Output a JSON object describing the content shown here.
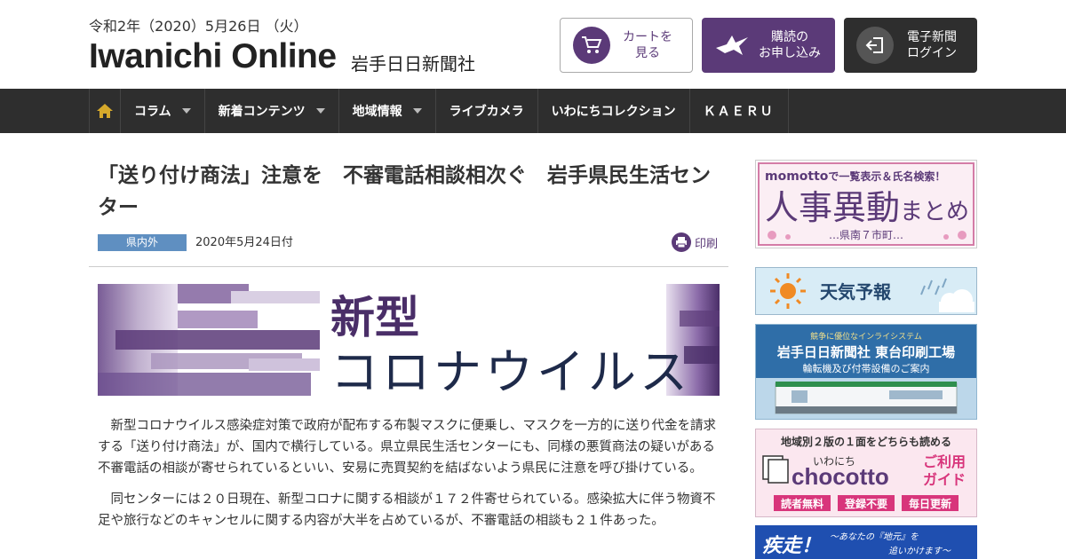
{
  "header": {
    "date": "令和2年（2020）5月26日 （火）",
    "logo": "Iwanichi Online",
    "logo_sub": "岩手日日新聞社",
    "cart_label": "カートを\n見る",
    "subscribe_label": "購読の\nお申し込み",
    "epaper_label": "電子新聞\nログイン"
  },
  "nav": {
    "items": [
      {
        "label": "コラム",
        "dropdown": true
      },
      {
        "label": "新着コンテンツ",
        "dropdown": true
      },
      {
        "label": "地域情報",
        "dropdown": true
      },
      {
        "label": "ライブカメラ",
        "dropdown": false
      },
      {
        "label": "いわにちコレクション",
        "dropdown": false
      },
      {
        "label": "ＫＡＥＲＵ",
        "dropdown": false
      }
    ]
  },
  "article": {
    "title": "「送り付け商法」注意を　不審電話相談相次ぐ　岩手県民生活センター",
    "category": "県内外",
    "date": "2020年5月24日付",
    "print_label": "印刷",
    "banner_line1": "新型",
    "banner_line2": "コロナウイルス",
    "paragraphs": [
      "新型コロナウイルス感染症対策で政府が配布する布製マスクに便乗し、マスクを一方的に送り代金を請求する「送り付け商法」が、国内で横行している。県立県民生活センターにも、同様の悪質商法の疑いがある不審電話の相談が寄せられているといい、安易に売買契約を結ばないよう県民に注意を呼び掛けている。",
      "同センターには２０日現在、新型コロナに関する相談が１７２件寄せられている。感染拡大に伴う物資不足や旅行などのキャンセルに関する内容が大半を占めているが、不審電話の相談も２１件あった。"
    ]
  },
  "sidebar": {
    "ad1": {
      "top_text_brand": "momotto",
      "top_text_rest": "で一覧表示＆氏名検索！",
      "main_big": "人事異動",
      "main_small": "まとめ",
      "bottom": "…県南７市町…"
    },
    "ad2": {
      "label": "天気予報"
    },
    "ad3": {
      "tagline": "競争に優位なインライシステム",
      "title": "岩手日日新聞社 東台印刷工場",
      "subtitle": "輪転機及び付帯設備のご案内"
    },
    "ad4": {
      "top": "地域別２版の１面をどちらも読める",
      "brand_small": "いわにち",
      "brand": "chocotto",
      "usage1": "ご利用",
      "usage2": "ガイド",
      "tag1": "読者無料",
      "tag2": "登録不要",
      "tag3": "毎日更新"
    },
    "ad5": {
      "main": "疾走！",
      "sub": "〜あなたの『地元』を",
      "sub2": "追いかけます〜"
    }
  },
  "colors": {
    "brand_purple": "#5b3a78",
    "nav_bg": "#2e2e2e",
    "category_blue": "#5f8fc1",
    "home_icon": "#d6a92b"
  },
  "icons": {
    "cart": "cart-icon",
    "subscribe": "bird-icon",
    "epaper": "login-icon",
    "home": "home-icon",
    "print": "printer-icon",
    "sun": "sun-icon",
    "cloud": "cloud-icon"
  }
}
